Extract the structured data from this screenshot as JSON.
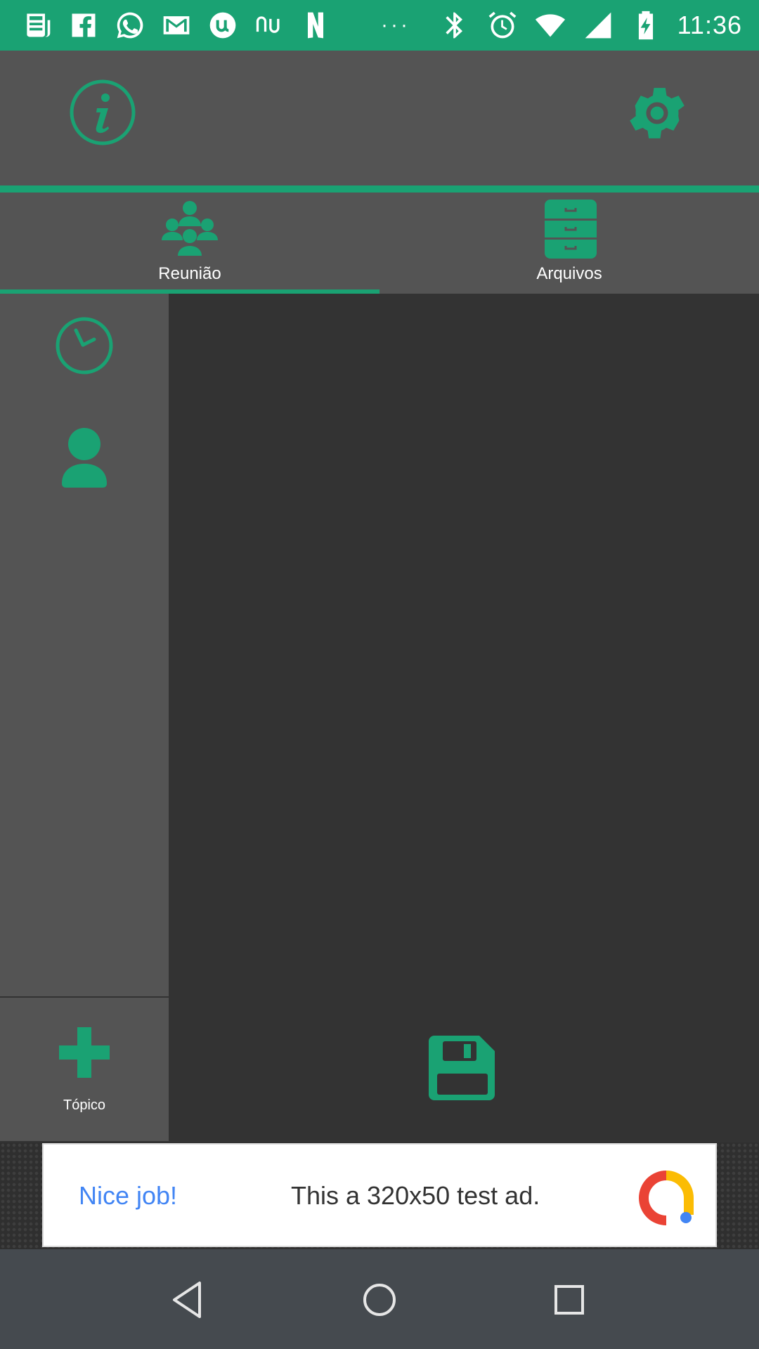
{
  "status_bar": {
    "time": "11:36",
    "overflow": "···",
    "left_icons": [
      "news-icon",
      "facebook-icon",
      "whatsapp-icon",
      "gmail-icon",
      "u-app-icon",
      "nubank-icon",
      "netflix-icon"
    ],
    "right_icons": [
      "bluetooth-icon",
      "alarm-icon",
      "wifi-icon",
      "signal-icon",
      "battery-charging-icon"
    ]
  },
  "toolbar": {
    "info_icon": "info-icon",
    "settings_icon": "gear-icon"
  },
  "tabs": [
    {
      "label": "Reunião",
      "icon": "people-group-icon",
      "selected": true
    },
    {
      "label": "Arquivos",
      "icon": "file-cabinet-icon",
      "selected": false
    }
  ],
  "side_panel": {
    "items": [
      "clock-icon",
      "user-icon"
    ]
  },
  "actions": {
    "topico_label": "Tópico",
    "save_icon": "floppy-disk-icon"
  },
  "ad": {
    "headline": "Nice job!",
    "text": "This a 320x50 test ad."
  },
  "colors": {
    "accent": "#1aa273",
    "toolbar_bg": "#545454",
    "content_bg": "#333333",
    "navbar_bg": "#454a4f"
  }
}
